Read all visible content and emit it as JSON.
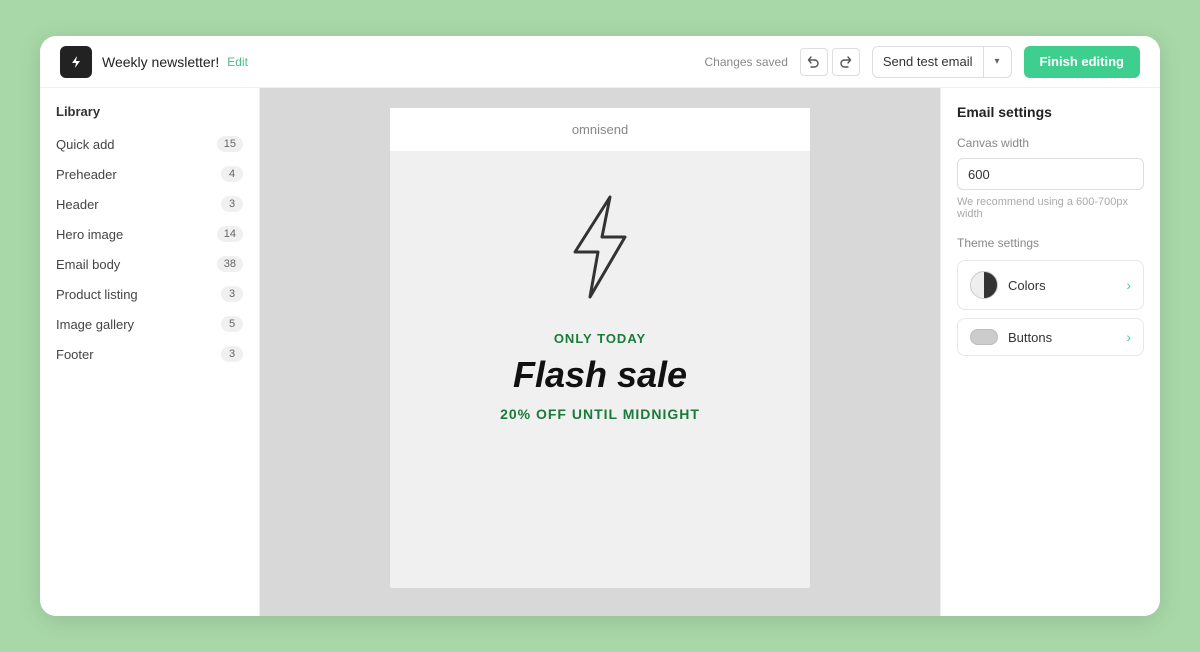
{
  "app": {
    "title": "Weekly newsletter!",
    "edit_label": "Edit",
    "changes_saved": "Changes saved",
    "undo_icon": "↺",
    "redo_icon": "↻",
    "send_test_label": "Send test email",
    "finish_label": "Finish editing",
    "logo_text": "⚡"
  },
  "sidebar": {
    "title": "Library",
    "items": [
      {
        "label": "Quick add",
        "count": "15"
      },
      {
        "label": "Preheader",
        "count": "4"
      },
      {
        "label": "Header",
        "count": "3"
      },
      {
        "label": "Hero image",
        "count": "14"
      },
      {
        "label": "Email body",
        "count": "38"
      },
      {
        "label": "Product listing",
        "count": "3"
      },
      {
        "label": "Image gallery",
        "count": "5"
      },
      {
        "label": "Footer",
        "count": "3"
      }
    ]
  },
  "email_preview": {
    "brand": "omnisend",
    "only_today": "ONLY TODAY",
    "flash_sale": "Flash sale",
    "discount": "20% OFF UNTIL MIDNIGHT"
  },
  "right_panel": {
    "title": "Email settings",
    "canvas_width_label": "Canvas width",
    "canvas_width_value": "600",
    "canvas_width_hint": "We recommend using a 600-700px width",
    "theme_label": "Theme settings",
    "theme_items": [
      {
        "name": "Colors",
        "type": "colors"
      },
      {
        "name": "Buttons",
        "type": "buttons"
      }
    ]
  }
}
